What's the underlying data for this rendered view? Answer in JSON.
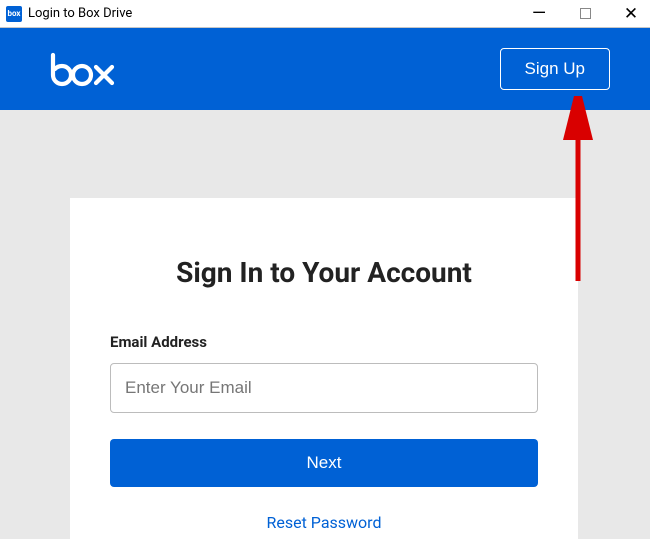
{
  "window": {
    "title": "Login to Box Drive",
    "app_icon_text": "box"
  },
  "header": {
    "logo_text": "box",
    "signup_label": "Sign Up"
  },
  "form": {
    "heading": "Sign In to Your Account",
    "email_label": "Email Address",
    "email_placeholder": "Enter Your Email",
    "next_label": "Next",
    "reset_label": "Reset Password"
  }
}
